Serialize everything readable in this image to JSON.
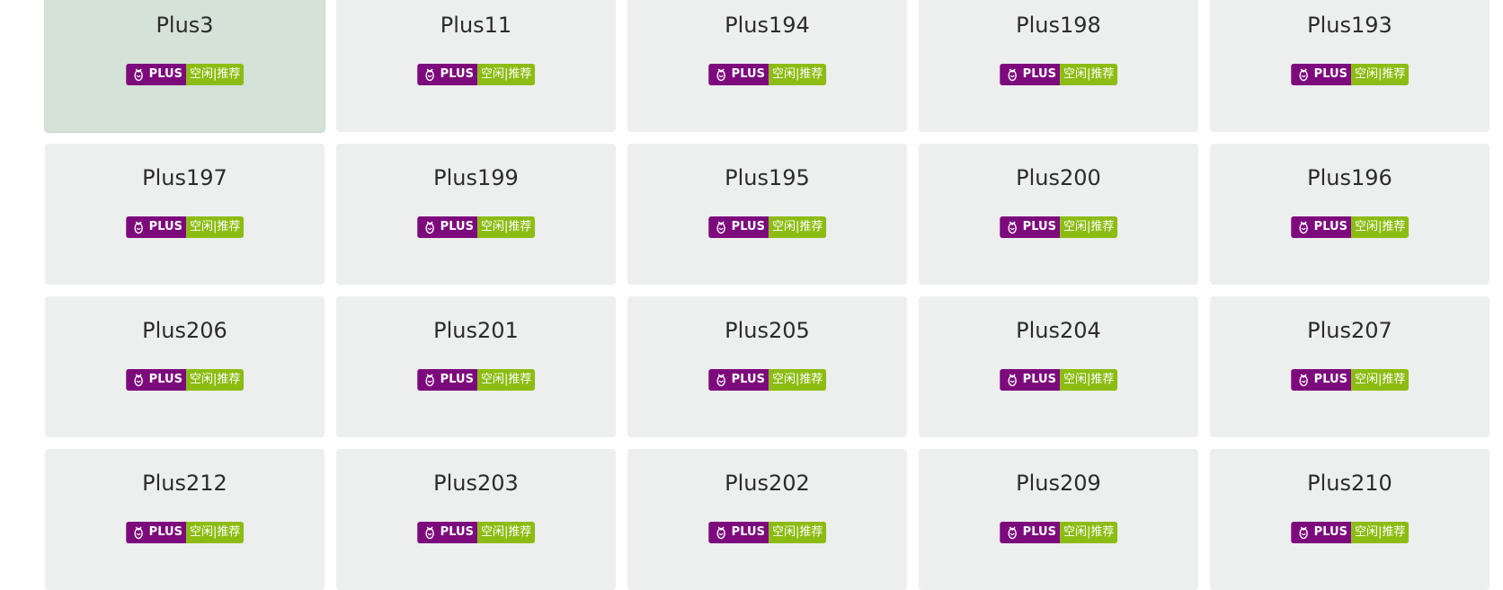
{
  "cards": [
    {
      "name": "Plus3",
      "active": true
    },
    {
      "name": "Plus11"
    },
    {
      "name": "Plus194"
    },
    {
      "name": "Plus198"
    },
    {
      "name": "Plus193"
    },
    {
      "name": "Plus197"
    },
    {
      "name": "Plus199"
    },
    {
      "name": "Plus195"
    },
    {
      "name": "Plus200"
    },
    {
      "name": "Plus196"
    },
    {
      "name": "Plus206"
    },
    {
      "name": "Plus201"
    },
    {
      "name": "Plus205"
    },
    {
      "name": "Plus204"
    },
    {
      "name": "Plus207"
    },
    {
      "name": "Plus212"
    },
    {
      "name": "Plus203"
    },
    {
      "name": "Plus202"
    },
    {
      "name": "Plus209"
    },
    {
      "name": "Plus210"
    }
  ],
  "badge": {
    "icon": "cocoon-logo-icon",
    "plan_label": "PLUS",
    "status_label": "空闲|推荐"
  },
  "colors": {
    "card_bg": "#edeeee",
    "card_active_bg": "#d4e2d8",
    "badge_plan_bg": "#7d0a7d",
    "badge_status_bg": "#8cbc12"
  }
}
